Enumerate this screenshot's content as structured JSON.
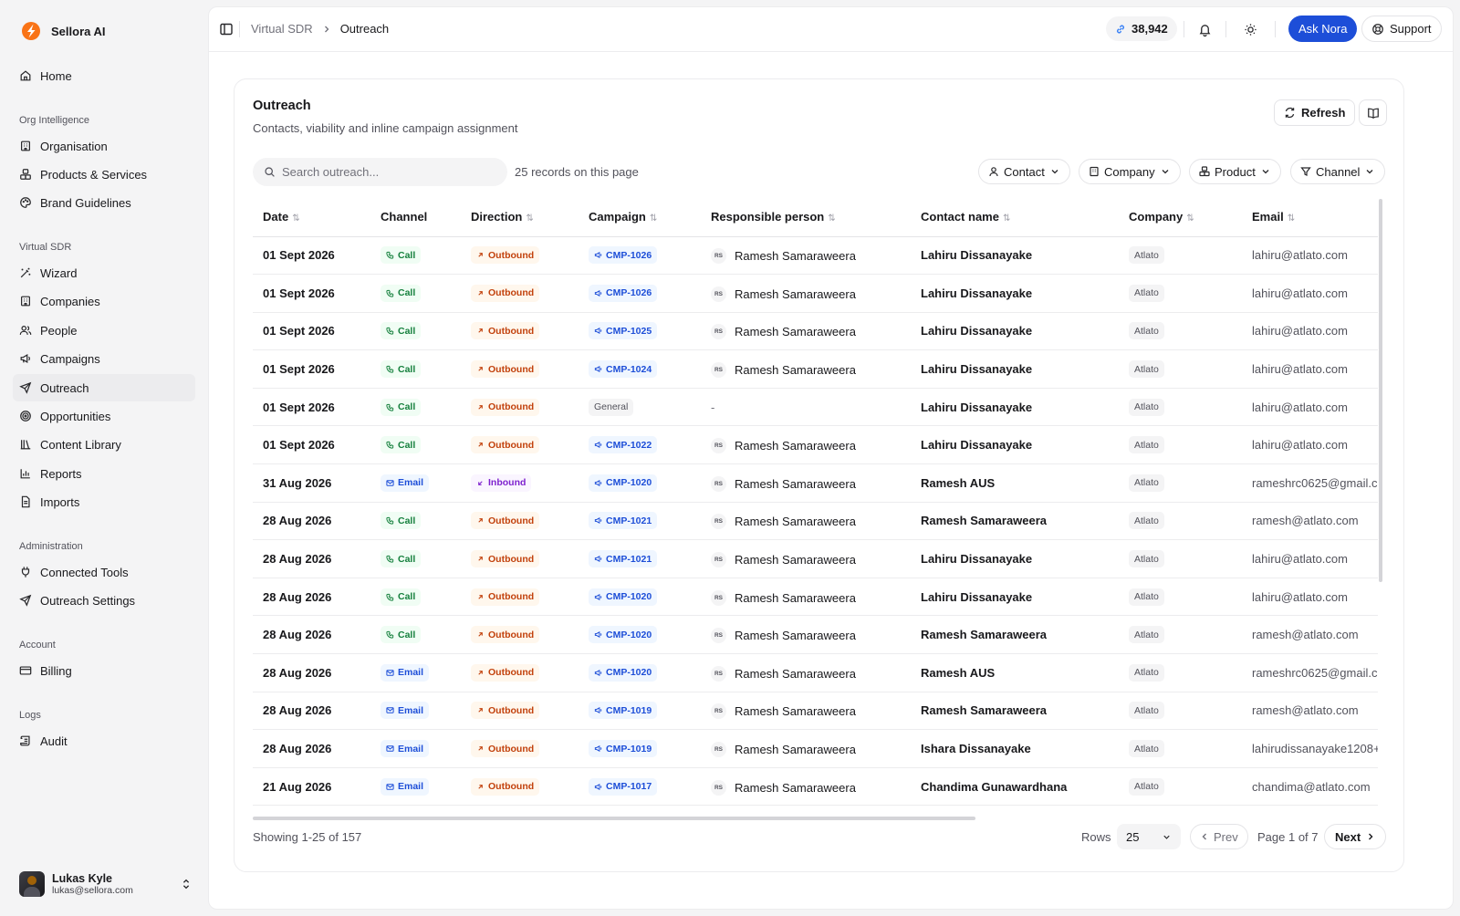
{
  "app": {
    "name": "Sellora AI"
  },
  "sidebar": {
    "home": "Home",
    "sections": [
      {
        "label": "Org Intelligence",
        "items": [
          "Organisation",
          "Products & Services",
          "Brand Guidelines"
        ]
      },
      {
        "label": "Virtual SDR",
        "items": [
          "Wizard",
          "Companies",
          "People",
          "Campaigns",
          "Outreach",
          "Opportunities",
          "Content Library",
          "Reports",
          "Imports"
        ]
      },
      {
        "label": "Administration",
        "items": [
          "Connected Tools",
          "Outreach Settings"
        ]
      },
      {
        "label": "Account",
        "items": [
          "Billing"
        ]
      },
      {
        "label": "Logs",
        "items": [
          "Audit"
        ]
      }
    ],
    "active_item": "Outreach",
    "user": {
      "name": "Lukas Kyle",
      "email": "lukas@sellora.com"
    }
  },
  "header": {
    "breadcrumb": [
      "Virtual SDR",
      "Outreach"
    ],
    "credits": "38,942",
    "ask_label": "Ask Nora",
    "support_label": "Support"
  },
  "card": {
    "title": "Outreach",
    "subtitle": "Contacts, viability and inline campaign assignment",
    "refresh_label": "Refresh",
    "search_placeholder": "Search outreach...",
    "records_text": "25 records on this page",
    "filters": [
      "Contact",
      "Company",
      "Product",
      "Channel"
    ]
  },
  "table": {
    "columns": [
      {
        "label": "Date",
        "sortable": true
      },
      {
        "label": "Channel",
        "sortable": false
      },
      {
        "label": "Direction",
        "sortable": true
      },
      {
        "label": "Campaign",
        "sortable": true
      },
      {
        "label": "Responsible person",
        "sortable": true
      },
      {
        "label": "Contact name",
        "sortable": true
      },
      {
        "label": "Company",
        "sortable": true
      },
      {
        "label": "Email",
        "sortable": true
      }
    ],
    "rows": [
      {
        "date": "01 Sept 2026",
        "channel": "Call",
        "direction": "Outbound",
        "campaign": "CMP-1026",
        "responsible": "Ramesh Samaraweera",
        "initials": "RS",
        "contact": "Lahiru Dissanayake",
        "company": "Atlato",
        "email": "lahiru@atlato.com"
      },
      {
        "date": "01 Sept 2026",
        "channel": "Call",
        "direction": "Outbound",
        "campaign": "CMP-1026",
        "responsible": "Ramesh Samaraweera",
        "initials": "RS",
        "contact": "Lahiru Dissanayake",
        "company": "Atlato",
        "email": "lahiru@atlato.com"
      },
      {
        "date": "01 Sept 2026",
        "channel": "Call",
        "direction": "Outbound",
        "campaign": "CMP-1025",
        "responsible": "Ramesh Samaraweera",
        "initials": "RS",
        "contact": "Lahiru Dissanayake",
        "company": "Atlato",
        "email": "lahiru@atlato.com"
      },
      {
        "date": "01 Sept 2026",
        "channel": "Call",
        "direction": "Outbound",
        "campaign": "CMP-1024",
        "responsible": "Ramesh Samaraweera",
        "initials": "RS",
        "contact": "Lahiru Dissanayake",
        "company": "Atlato",
        "email": "lahiru@atlato.com"
      },
      {
        "date": "01 Sept 2026",
        "channel": "Call",
        "direction": "Outbound",
        "campaign": "General",
        "responsible": "-",
        "initials": "",
        "contact": "Lahiru Dissanayake",
        "company": "Atlato",
        "email": "lahiru@atlato.com"
      },
      {
        "date": "01 Sept 2026",
        "channel": "Call",
        "direction": "Outbound",
        "campaign": "CMP-1022",
        "responsible": "Ramesh Samaraweera",
        "initials": "RS",
        "contact": "Lahiru Dissanayake",
        "company": "Atlato",
        "email": "lahiru@atlato.com"
      },
      {
        "date": "31 Aug 2026",
        "channel": "Email",
        "direction": "Inbound",
        "campaign": "CMP-1020",
        "responsible": "Ramesh Samaraweera",
        "initials": "RS",
        "contact": "Ramesh AUS",
        "company": "Atlato",
        "email": "rameshrc0625@gmail.c"
      },
      {
        "date": "28 Aug 2026",
        "channel": "Call",
        "direction": "Outbound",
        "campaign": "CMP-1021",
        "responsible": "Ramesh Samaraweera",
        "initials": "RS",
        "contact": "Ramesh Samaraweera",
        "company": "Atlato",
        "email": "ramesh@atlato.com"
      },
      {
        "date": "28 Aug 2026",
        "channel": "Call",
        "direction": "Outbound",
        "campaign": "CMP-1021",
        "responsible": "Ramesh Samaraweera",
        "initials": "RS",
        "contact": "Lahiru Dissanayake",
        "company": "Atlato",
        "email": "lahiru@atlato.com"
      },
      {
        "date": "28 Aug 2026",
        "channel": "Call",
        "direction": "Outbound",
        "campaign": "CMP-1020",
        "responsible": "Ramesh Samaraweera",
        "initials": "RS",
        "contact": "Lahiru Dissanayake",
        "company": "Atlato",
        "email": "lahiru@atlato.com"
      },
      {
        "date": "28 Aug 2026",
        "channel": "Call",
        "direction": "Outbound",
        "campaign": "CMP-1020",
        "responsible": "Ramesh Samaraweera",
        "initials": "RS",
        "contact": "Ramesh Samaraweera",
        "company": "Atlato",
        "email": "ramesh@atlato.com"
      },
      {
        "date": "28 Aug 2026",
        "channel": "Email",
        "direction": "Outbound",
        "campaign": "CMP-1020",
        "responsible": "Ramesh Samaraweera",
        "initials": "RS",
        "contact": "Ramesh AUS",
        "company": "Atlato",
        "email": "rameshrc0625@gmail.c"
      },
      {
        "date": "28 Aug 2026",
        "channel": "Email",
        "direction": "Outbound",
        "campaign": "CMP-1019",
        "responsible": "Ramesh Samaraweera",
        "initials": "RS",
        "contact": "Ramesh Samaraweera",
        "company": "Atlato",
        "email": "ramesh@atlato.com"
      },
      {
        "date": "28 Aug 2026",
        "channel": "Email",
        "direction": "Outbound",
        "campaign": "CMP-1019",
        "responsible": "Ramesh Samaraweera",
        "initials": "RS",
        "contact": "Ishara Dissanayake",
        "company": "Atlato",
        "email": "lahirudissanayake1208+"
      },
      {
        "date": "21 Aug 2026",
        "channel": "Email",
        "direction": "Outbound",
        "campaign": "CMP-1017",
        "responsible": "Ramesh Samaraweera",
        "initials": "RS",
        "contact": "Chandima Gunawardhana",
        "company": "Atlato",
        "email": "chandima@atlato.com"
      }
    ]
  },
  "pagination": {
    "showing": "Showing 1-25 of 157",
    "rows_label": "Rows",
    "rows_value": "25",
    "prev_label": "Prev",
    "page_info": "Page 1 of 7",
    "next_label": "Next"
  },
  "colors": {
    "accent": "#1d4ed8",
    "brand": "#f97316"
  }
}
